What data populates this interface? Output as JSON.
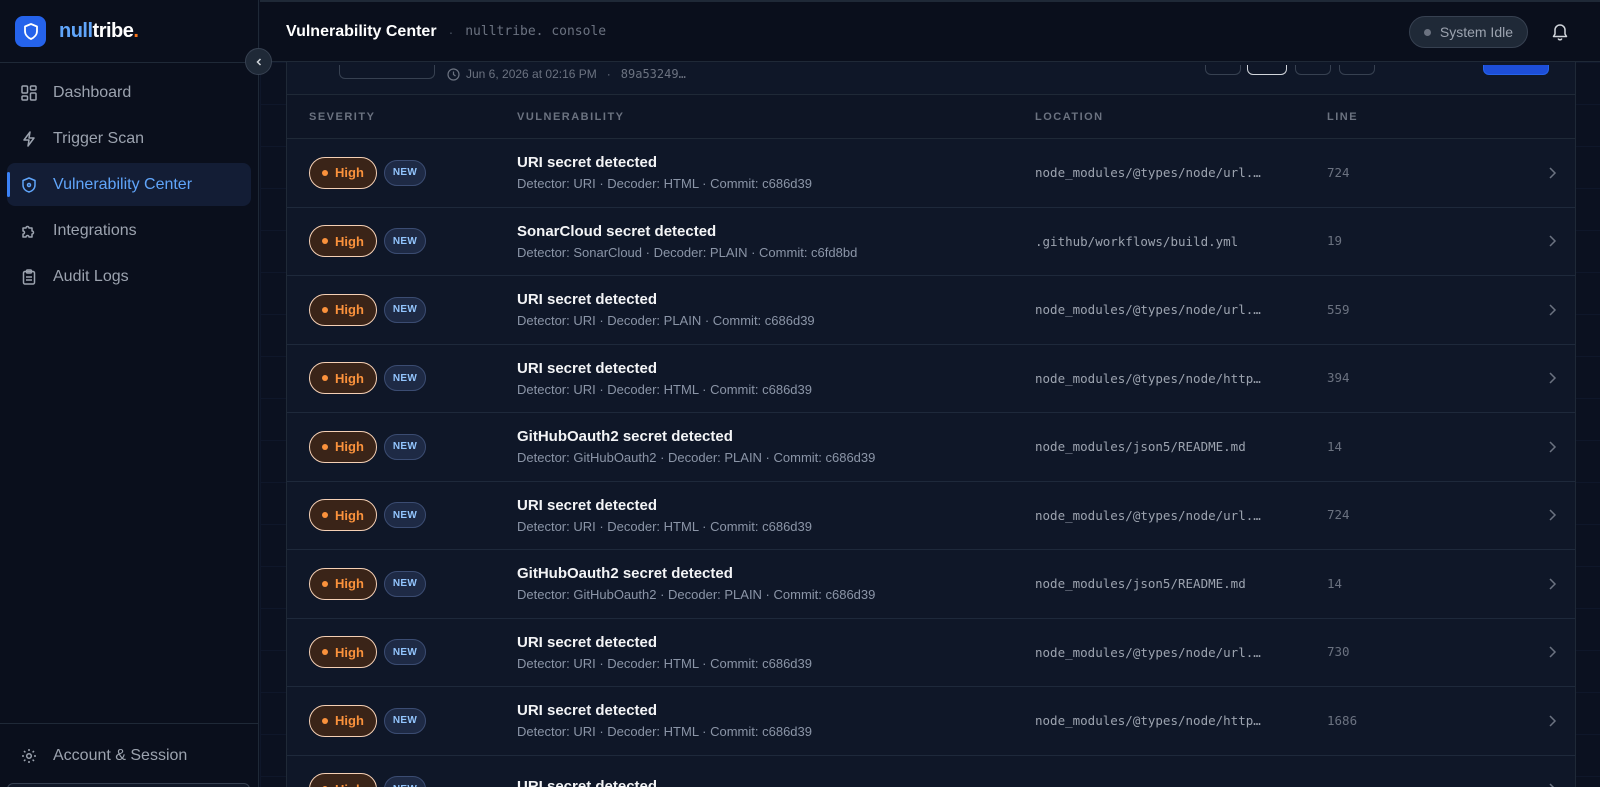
{
  "brand": {
    "name_a": "null",
    "name_b": "tribe",
    "name_dot": "."
  },
  "sidebar": {
    "items": [
      {
        "label": "Dashboard",
        "icon": "dashboard-icon"
      },
      {
        "label": "Trigger Scan",
        "icon": "lightning-icon"
      },
      {
        "label": "Vulnerability Center",
        "icon": "shield-icon",
        "active": true
      },
      {
        "label": "Integrations",
        "icon": "puzzle-icon"
      },
      {
        "label": "Audit Logs",
        "icon": "clipboard-icon"
      }
    ],
    "footer_label": "Account & Session"
  },
  "header": {
    "title": "Vulnerability Center",
    "separator": "·",
    "subtitle": "nulltribe. console",
    "status": "System Idle"
  },
  "scan": {
    "timestamp": "Jun 6, 2026 at 02:16 PM",
    "separator": "·",
    "hash": "89a53249…"
  },
  "table": {
    "headers": {
      "severity": "SEVERITY",
      "vulnerability": "VULNERABILITY",
      "location": "LOCATION",
      "line": "LINE"
    },
    "rows": [
      {
        "severity": "High",
        "badge": "NEW",
        "title": "URI secret detected",
        "meta": "Detector: URI · Decoder: HTML · Commit: c686d39",
        "location": "node_modules/@types/node/url.…",
        "line": "724"
      },
      {
        "severity": "High",
        "badge": "NEW",
        "title": "SonarCloud secret detected",
        "meta": "Detector: SonarCloud · Decoder: PLAIN · Commit: c6fd8bd",
        "location": ".github/workflows/build.yml",
        "line": "19"
      },
      {
        "severity": "High",
        "badge": "NEW",
        "title": "URI secret detected",
        "meta": "Detector: URI · Decoder: PLAIN · Commit: c686d39",
        "location": "node_modules/@types/node/url.…",
        "line": "559"
      },
      {
        "severity": "High",
        "badge": "NEW",
        "title": "URI secret detected",
        "meta": "Detector: URI · Decoder: HTML · Commit: c686d39",
        "location": "node_modules/@types/node/http…",
        "line": "394"
      },
      {
        "severity": "High",
        "badge": "NEW",
        "title": "GitHubOauth2 secret detected",
        "meta": "Detector: GitHubOauth2 · Decoder: PLAIN · Commit: c686d39",
        "location": "node_modules/json5/README.md",
        "line": "14"
      },
      {
        "severity": "High",
        "badge": "NEW",
        "title": "URI secret detected",
        "meta": "Detector: URI · Decoder: HTML · Commit: c686d39",
        "location": "node_modules/@types/node/url.…",
        "line": "724"
      },
      {
        "severity": "High",
        "badge": "NEW",
        "title": "GitHubOauth2 secret detected",
        "meta": "Detector: GitHubOauth2 · Decoder: PLAIN · Commit: c686d39",
        "location": "node_modules/json5/README.md",
        "line": "14"
      },
      {
        "severity": "High",
        "badge": "NEW",
        "title": "URI secret detected",
        "meta": "Detector: URI · Decoder: HTML · Commit: c686d39",
        "location": "node_modules/@types/node/url.…",
        "line": "730"
      },
      {
        "severity": "High",
        "badge": "NEW",
        "title": "URI secret detected",
        "meta": "Detector: URI · Decoder: HTML · Commit: c686d39",
        "location": "node_modules/@types/node/http…",
        "line": "1686"
      },
      {
        "severity": "High",
        "badge": "NEW",
        "title": "URI secret detected",
        "meta": "",
        "location": "",
        "line": ""
      }
    ]
  },
  "colors": {
    "accent": "#3b82f6",
    "severity_high": "#fb923c",
    "background": "#0b1120"
  }
}
